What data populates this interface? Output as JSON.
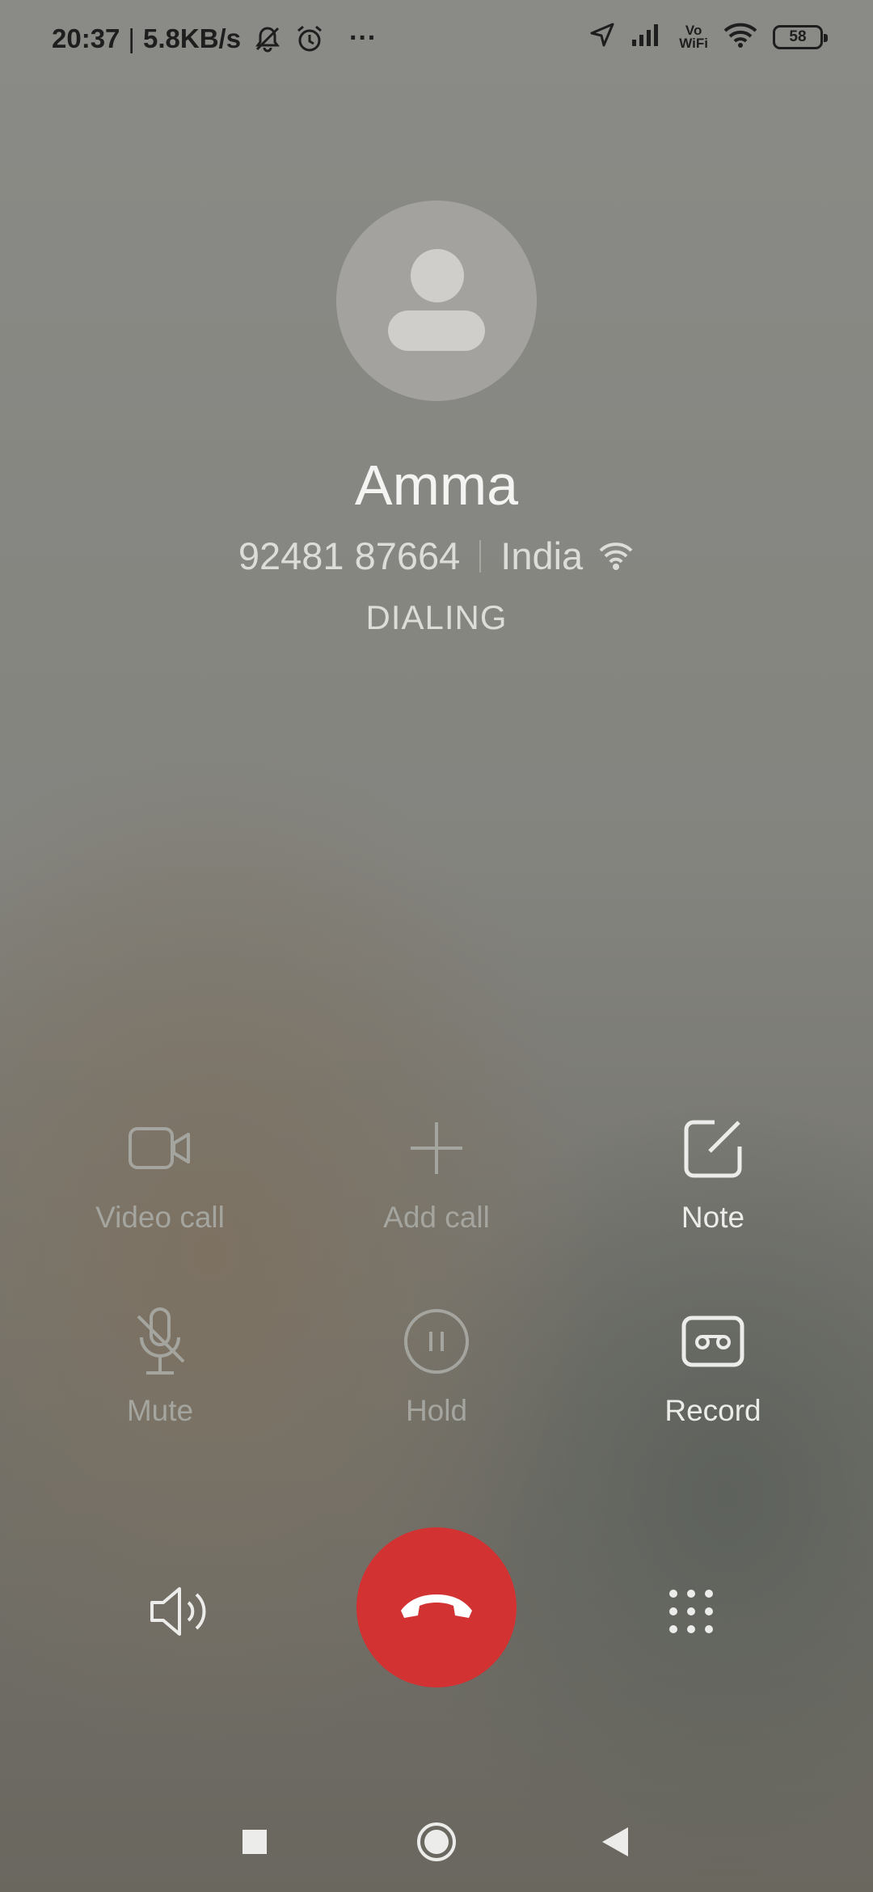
{
  "status_bar": {
    "time": "20:37",
    "separator": "|",
    "net_speed": "5.8KB/s",
    "more": "···",
    "vowifi_line1": "Vo",
    "vowifi_line2": "WiFi",
    "battery": "58",
    "icons": [
      "bell-off-icon",
      "alarm-icon",
      "location-icon",
      "signal-icon",
      "wifi-icon",
      "battery-icon"
    ]
  },
  "contact": {
    "name": "Amma",
    "number": "92481 87664",
    "region": "India",
    "state": "DIALING"
  },
  "actions": [
    {
      "label": "Video call",
      "icon": "video-camera-icon",
      "enabled": false
    },
    {
      "label": "Add call",
      "icon": "plus-icon",
      "enabled": false
    },
    {
      "label": "Note",
      "icon": "note-edit-icon",
      "enabled": true
    },
    {
      "label": "Mute",
      "icon": "microphone-off-icon",
      "enabled": false
    },
    {
      "label": "Hold",
      "icon": "pause-icon",
      "enabled": false
    },
    {
      "label": "Record",
      "icon": "record-tape-icon",
      "enabled": true
    }
  ],
  "controls": {
    "speaker_icon": "speaker-icon",
    "end_call_icon": "phone-hangup-icon",
    "keypad_icon": "dialpad-icon",
    "end_call_color": "#d33232"
  },
  "nav": [
    "recents-square-icon",
    "home-circle-icon",
    "back-triangle-icon"
  ]
}
